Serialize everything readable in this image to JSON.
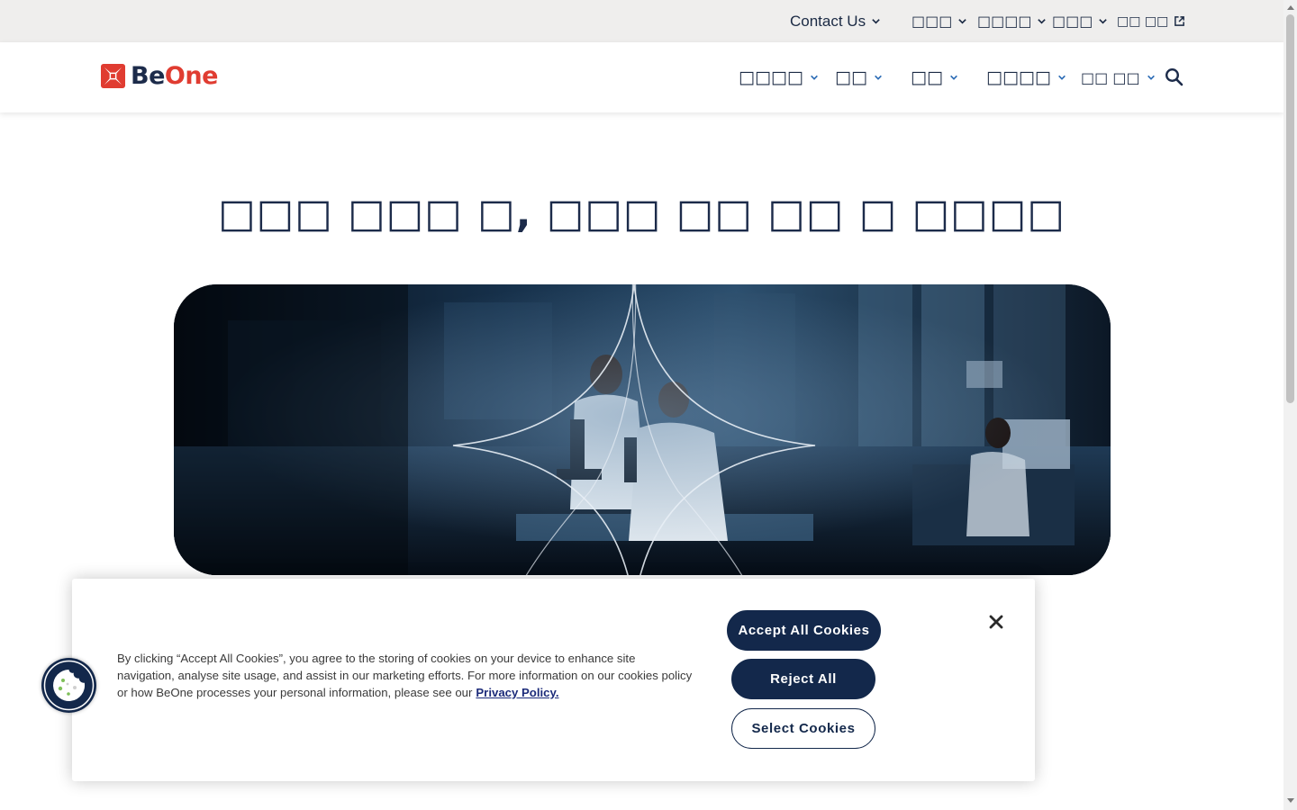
{
  "utility_nav": {
    "contact": "Contact Us",
    "item_2": "□□□",
    "item_3": "□□□□",
    "item_4": "□□□",
    "item_5": "□□ □□"
  },
  "brand": {
    "name_part1": "Be",
    "name_part2": "One",
    "primary_color": "#1c2b4a",
    "accent_color": "#e03c31"
  },
  "main_nav": {
    "items": [
      {
        "label": "□□□□",
        "icon": "chevron-down-icon"
      },
      {
        "label": "□□",
        "icon": "chevron-down-icon"
      },
      {
        "label": "□□",
        "icon": "chevron-down-icon"
      },
      {
        "label": "□□□□",
        "icon": "chevron-down-icon"
      },
      {
        "label": "□□ □□",
        "icon": "chevron-down-icon"
      }
    ],
    "search_icon": "search-icon"
  },
  "hero": {
    "title": "□□□ □□□ □, □□□ □□ □□ □ □□□□"
  },
  "cookie_banner": {
    "text": "By clicking “Accept All Cookies”, you agree to the storing of cookies on your device to enhance site navigation, analyse site usage, and assist in our marketing efforts. For more information on our cookies policy or how BeOne processes your personal information, please see our",
    "link_text": "Privacy Policy.",
    "accept_label": "Accept All Cookies",
    "reject_label": "Reject All",
    "select_label": "Select Cookies",
    "close_icon": "close-icon",
    "button_color": "#13284b"
  },
  "cookie_settings_icon": "cookie-icon"
}
